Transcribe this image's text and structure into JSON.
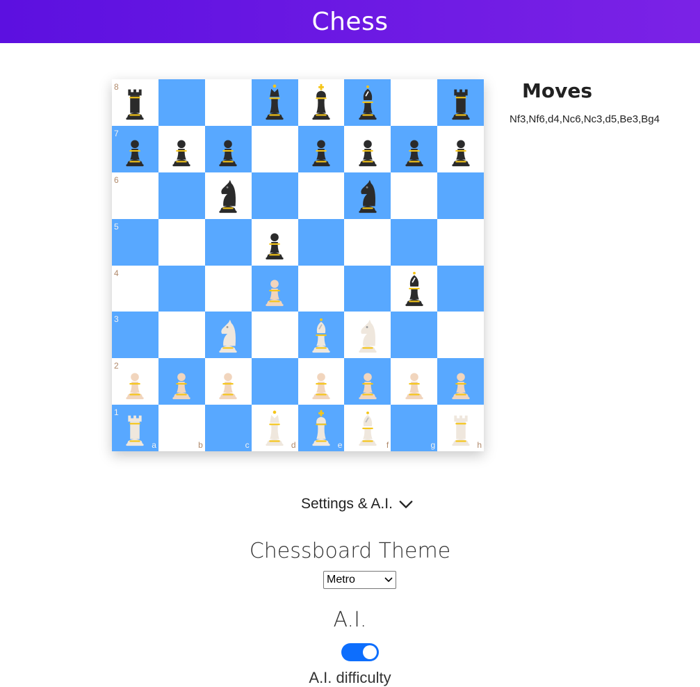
{
  "header": {
    "title": "Chess"
  },
  "board": {
    "theme_colors": {
      "light": "#ffffff",
      "dark": "#58a8ff",
      "piece_black": "#2b2b2b",
      "piece_white": "#efe7dd",
      "pawn_white": "#f1d5bd",
      "accent": "#f5c518"
    },
    "rank_labels": [
      "8",
      "7",
      "6",
      "5",
      "4",
      "3",
      "2",
      "1"
    ],
    "file_labels": [
      "a",
      "b",
      "c",
      "d",
      "e",
      "f",
      "g",
      "h"
    ],
    "position": [
      [
        "bR",
        "",
        "",
        "bQ",
        "bK",
        "bB",
        "",
        "bR"
      ],
      [
        "bP",
        "bP",
        "bP",
        "",
        "bP",
        "bP",
        "bP",
        "bP"
      ],
      [
        "",
        "",
        "bN",
        "",
        "",
        "bN",
        "",
        ""
      ],
      [
        "",
        "",
        "",
        "bP",
        "",
        "",
        "",
        ""
      ],
      [
        "",
        "",
        "",
        "wP",
        "",
        "",
        "bB",
        ""
      ],
      [
        "",
        "",
        "wN",
        "",
        "wB",
        "wN",
        "",
        ""
      ],
      [
        "wP",
        "wP",
        "wP",
        "",
        "wP",
        "wP",
        "wP",
        "wP"
      ],
      [
        "wR",
        "",
        "",
        "wQ",
        "wK",
        "wB",
        "",
        "wR"
      ]
    ]
  },
  "moves": {
    "title": "Moves",
    "list": "Nf3,Nf6,d4,Nc6,Nc3,d5,Be3,Bg4"
  },
  "settings": {
    "toggle_label": "Settings & A.I.",
    "theme_title": "Chessboard Theme",
    "theme_selected": "Metro",
    "ai_title": "A.I.",
    "ai_enabled": true,
    "difficulty_label": "A.I. difficulty"
  }
}
